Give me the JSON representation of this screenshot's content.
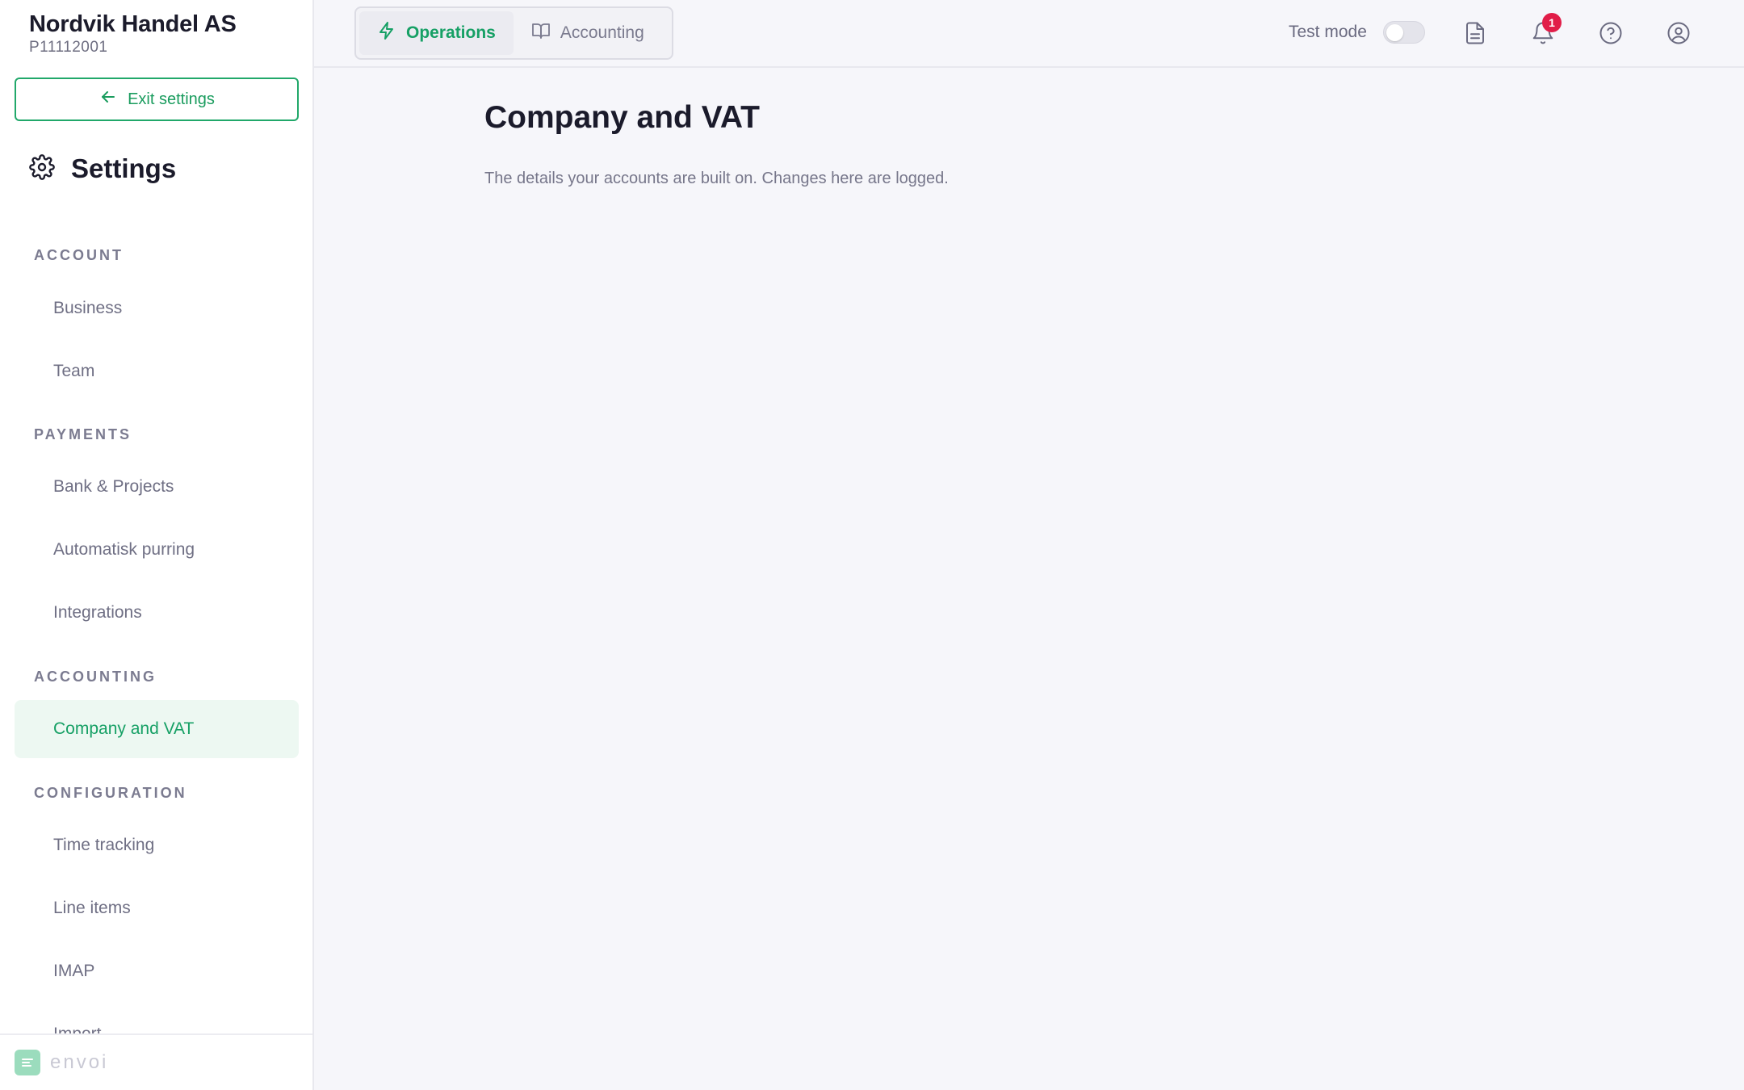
{
  "org": {
    "name": "Nordvik Handel AS",
    "id": "P11112001"
  },
  "sidebar": {
    "exit_label": "Exit settings",
    "title": "Settings",
    "sections": {
      "account": "ACCOUNT",
      "payments": "PAYMENTS",
      "accounting": "ACCOUNTING",
      "configuration": "CONFIGURATION"
    },
    "items": {
      "business": "Business",
      "team": "Team",
      "bank_projects": "Bank & Projects",
      "automatisk_purring": "Automatisk purring",
      "integrations": "Integrations",
      "company_vat": "Company and VAT",
      "time_tracking": "Time tracking",
      "line_items": "Line items",
      "imap": "IMAP",
      "import": "Import"
    },
    "active_item": "Company and VAT",
    "footer_logo": "envoi"
  },
  "topbar": {
    "tabs": [
      {
        "label": "Operations",
        "active": true,
        "icon": "bolt-icon"
      },
      {
        "label": "Accounting",
        "active": false,
        "icon": "book-icon"
      }
    ],
    "test_mode_label": "Test mode",
    "test_mode_on": false,
    "notification_count": "1",
    "icons": [
      "document-icon",
      "bell-icon",
      "help-icon",
      "user-icon"
    ]
  },
  "main": {
    "title": "Company and VAT",
    "subtitle": "The details your accounts are built on. Changes here are logged."
  },
  "colors": {
    "accent": "#16a065",
    "active_bg": "#edf8f2",
    "badge": "#e11d48",
    "background": "#f6f6fa"
  }
}
